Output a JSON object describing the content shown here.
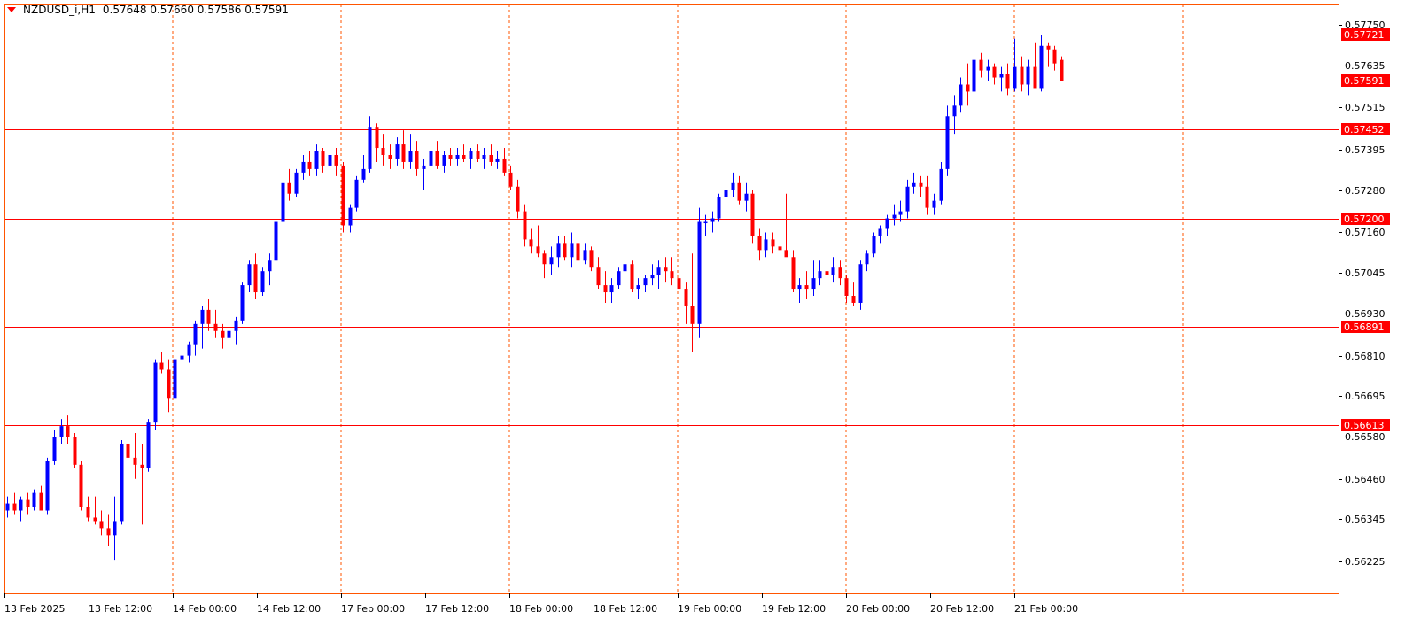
{
  "window": {
    "symbol_line": "NZDUSD_i,H1",
    "ohlc": "0.57648 0.57660 0.57586 0.57591"
  },
  "colors": {
    "bull": "#0000ff",
    "bear": "#ff0000",
    "grid": "#ff5500",
    "level_line": "#ff0000",
    "frame": "#ff5500"
  },
  "chart_data": {
    "type": "candlestick",
    "timeframe": "H1",
    "ylim": [
      0.5616,
      0.5779
    ],
    "y_ticks": [
      "0.57750",
      "0.57635",
      "0.57515",
      "0.57395",
      "0.57280",
      "0.57160",
      "0.57045",
      "0.56930",
      "0.56810",
      "0.56695",
      "0.56580",
      "0.56460",
      "0.56345",
      "0.56225"
    ],
    "x_labels": [
      "13 Feb 2025",
      "13 Feb 12:00",
      "14 Feb 00:00",
      "14 Feb 12:00",
      "17 Feb 00:00",
      "17 Feb 12:00",
      "18 Feb 00:00",
      "18 Feb 12:00",
      "19 Feb 00:00",
      "19 Feb 12:00",
      "20 Feb 00:00",
      "20 Feb 12:00",
      "21 Feb 00:00"
    ],
    "horizontal_levels": [
      {
        "label": "0.57721",
        "value": 0.57721
      },
      {
        "label": "0.57452",
        "value": 0.57452
      },
      {
        "label": "0.57200",
        "value": 0.572
      },
      {
        "label": "0.56891",
        "value": 0.56891
      },
      {
        "label": "0.56613",
        "value": 0.56613
      }
    ],
    "current_price": {
      "label": "0.57591",
      "value": 0.57591
    },
    "candles": [
      [
        0.5637,
        0.5641,
        0.5635,
        0.5639
      ],
      [
        0.5639,
        0.5642,
        0.5636,
        0.5637
      ],
      [
        0.5637,
        0.5641,
        0.5634,
        0.564
      ],
      [
        0.564,
        0.5642,
        0.5636,
        0.5638
      ],
      [
        0.5638,
        0.5643,
        0.5637,
        0.5642
      ],
      [
        0.5642,
        0.5644,
        0.5637,
        0.5637
      ],
      [
        0.5637,
        0.5652,
        0.5636,
        0.5651
      ],
      [
        0.5651,
        0.566,
        0.565,
        0.5658
      ],
      [
        0.5658,
        0.5663,
        0.5656,
        0.5661
      ],
      [
        0.5661,
        0.5664,
        0.5656,
        0.5658
      ],
      [
        0.5658,
        0.5659,
        0.5649,
        0.565
      ],
      [
        0.565,
        0.5651,
        0.5637,
        0.5638
      ],
      [
        0.5638,
        0.5641,
        0.5634,
        0.5635
      ],
      [
        0.5635,
        0.5641,
        0.5633,
        0.5634
      ],
      [
        0.5634,
        0.5637,
        0.563,
        0.5632
      ],
      [
        0.5632,
        0.5636,
        0.5627,
        0.563
      ],
      [
        0.563,
        0.5641,
        0.5623,
        0.5634
      ],
      [
        0.5634,
        0.5657,
        0.5633,
        0.5656
      ],
      [
        0.5656,
        0.5661,
        0.5649,
        0.5652
      ],
      [
        0.5652,
        0.5659,
        0.5646,
        0.565
      ],
      [
        0.565,
        0.5656,
        0.5633,
        0.5649
      ],
      [
        0.5649,
        0.5663,
        0.5648,
        0.5662
      ],
      [
        0.5662,
        0.568,
        0.566,
        0.5679
      ],
      [
        0.5679,
        0.5682,
        0.5676,
        0.5677
      ],
      [
        0.5677,
        0.568,
        0.5665,
        0.5669
      ],
      [
        0.5669,
        0.5681,
        0.5667,
        0.568
      ],
      [
        0.568,
        0.5682,
        0.5676,
        0.5681
      ],
      [
        0.5681,
        0.5685,
        0.5679,
        0.5684
      ],
      [
        0.5684,
        0.5691,
        0.5681,
        0.569
      ],
      [
        0.569,
        0.5695,
        0.5683,
        0.5694
      ],
      [
        0.5694,
        0.5697,
        0.5688,
        0.569
      ],
      [
        0.569,
        0.5694,
        0.5686,
        0.5688
      ],
      [
        0.5688,
        0.569,
        0.5683,
        0.5686
      ],
      [
        0.5686,
        0.569,
        0.5683,
        0.5688
      ],
      [
        0.5688,
        0.5692,
        0.5684,
        0.5691
      ],
      [
        0.5691,
        0.5702,
        0.569,
        0.5701
      ],
      [
        0.5701,
        0.5708,
        0.5699,
        0.5707
      ],
      [
        0.5707,
        0.571,
        0.5697,
        0.5699
      ],
      [
        0.5699,
        0.5706,
        0.5698,
        0.5705
      ],
      [
        0.5705,
        0.571,
        0.5701,
        0.5708
      ],
      [
        0.5708,
        0.5722,
        0.5707,
        0.5719
      ],
      [
        0.5719,
        0.5731,
        0.5717,
        0.573
      ],
      [
        0.573,
        0.5734,
        0.5725,
        0.5727
      ],
      [
        0.5727,
        0.5734,
        0.5726,
        0.5733
      ],
      [
        0.5733,
        0.5738,
        0.5731,
        0.5736
      ],
      [
        0.5736,
        0.5739,
        0.5732,
        0.5734
      ],
      [
        0.5734,
        0.5741,
        0.5732,
        0.5739
      ],
      [
        0.5739,
        0.574,
        0.5733,
        0.5735
      ],
      [
        0.5735,
        0.5741,
        0.5733,
        0.5738
      ],
      [
        0.5738,
        0.574,
        0.5732,
        0.5735
      ],
      [
        0.5735,
        0.5736,
        0.5716,
        0.5718
      ],
      [
        0.5718,
        0.5724,
        0.5716,
        0.5723
      ],
      [
        0.5723,
        0.5732,
        0.5722,
        0.5731
      ],
      [
        0.5731,
        0.5738,
        0.573,
        0.5734
      ],
      [
        0.5734,
        0.5749,
        0.5733,
        0.5746
      ],
      [
        0.5746,
        0.5747,
        0.5736,
        0.574
      ],
      [
        0.574,
        0.5744,
        0.5735,
        0.5738
      ],
      [
        0.5738,
        0.5741,
        0.5734,
        0.5737
      ],
      [
        0.5737,
        0.5743,
        0.5735,
        0.5741
      ],
      [
        0.5741,
        0.5745,
        0.5734,
        0.5736
      ],
      [
        0.5736,
        0.5744,
        0.5734,
        0.5739
      ],
      [
        0.5739,
        0.5742,
        0.5732,
        0.5734
      ],
      [
        0.5734,
        0.5737,
        0.5728,
        0.5735
      ],
      [
        0.5735,
        0.5741,
        0.5733,
        0.5739
      ],
      [
        0.5739,
        0.5742,
        0.5734,
        0.5735
      ],
      [
        0.5735,
        0.5739,
        0.5733,
        0.5738
      ],
      [
        0.5738,
        0.574,
        0.5735,
        0.5737
      ],
      [
        0.5737,
        0.574,
        0.5735,
        0.5738
      ],
      [
        0.5738,
        0.5741,
        0.5736,
        0.5737
      ],
      [
        0.5737,
        0.574,
        0.5734,
        0.5739
      ],
      [
        0.5739,
        0.5741,
        0.5736,
        0.5737
      ],
      [
        0.5737,
        0.574,
        0.5734,
        0.5738
      ],
      [
        0.5738,
        0.5741,
        0.5735,
        0.5736
      ],
      [
        0.5736,
        0.5739,
        0.5734,
        0.5737
      ],
      [
        0.5737,
        0.574,
        0.5732,
        0.5733
      ],
      [
        0.5733,
        0.5735,
        0.5728,
        0.5729
      ],
      [
        0.5729,
        0.5731,
        0.572,
        0.5722
      ],
      [
        0.5722,
        0.5724,
        0.5712,
        0.5714
      ],
      [
        0.5714,
        0.5717,
        0.571,
        0.5712
      ],
      [
        0.5712,
        0.5718,
        0.5709,
        0.571
      ],
      [
        0.571,
        0.5711,
        0.5703,
        0.5707
      ],
      [
        0.5707,
        0.5712,
        0.5704,
        0.5709
      ],
      [
        0.5709,
        0.5715,
        0.5706,
        0.5713
      ],
      [
        0.5713,
        0.5715,
        0.5708,
        0.5709
      ],
      [
        0.5709,
        0.5716,
        0.5706,
        0.5713
      ],
      [
        0.5713,
        0.5714,
        0.5707,
        0.5708
      ],
      [
        0.5708,
        0.5713,
        0.5707,
        0.5711
      ],
      [
        0.5711,
        0.5712,
        0.5705,
        0.5706
      ],
      [
        0.5706,
        0.5709,
        0.57,
        0.5701
      ],
      [
        0.5701,
        0.5705,
        0.5696,
        0.5699
      ],
      [
        0.5699,
        0.5703,
        0.5696,
        0.5701
      ],
      [
        0.5701,
        0.5706,
        0.57,
        0.5705
      ],
      [
        0.5705,
        0.5709,
        0.5703,
        0.5707
      ],
      [
        0.5707,
        0.5708,
        0.5699,
        0.57
      ],
      [
        0.57,
        0.5703,
        0.5697,
        0.5701
      ],
      [
        0.5701,
        0.5704,
        0.5699,
        0.5703
      ],
      [
        0.5703,
        0.5707,
        0.5701,
        0.5704
      ],
      [
        0.5704,
        0.5708,
        0.57,
        0.5706
      ],
      [
        0.5706,
        0.5709,
        0.5702,
        0.5705
      ],
      [
        0.5705,
        0.5709,
        0.5701,
        0.5703
      ],
      [
        0.5703,
        0.5706,
        0.5699,
        0.57
      ],
      [
        0.57,
        0.5702,
        0.569,
        0.5695
      ],
      [
        0.5695,
        0.571,
        0.5682,
        0.569
      ],
      [
        0.569,
        0.5723,
        0.5686,
        0.5719
      ],
      [
        0.5719,
        0.5721,
        0.5715,
        0.5719
      ],
      [
        0.5719,
        0.5722,
        0.5716,
        0.572
      ],
      [
        0.572,
        0.5727,
        0.5719,
        0.5726
      ],
      [
        0.5726,
        0.5729,
        0.5723,
        0.5728
      ],
      [
        0.5728,
        0.5733,
        0.5726,
        0.573
      ],
      [
        0.573,
        0.5732,
        0.5724,
        0.5725
      ],
      [
        0.5725,
        0.573,
        0.5722,
        0.5727
      ],
      [
        0.5727,
        0.5728,
        0.5713,
        0.5715
      ],
      [
        0.5715,
        0.5717,
        0.5708,
        0.5711
      ],
      [
        0.5711,
        0.5716,
        0.5709,
        0.5714
      ],
      [
        0.5714,
        0.5716,
        0.571,
        0.5712
      ],
      [
        0.5712,
        0.5717,
        0.5709,
        0.5711
      ],
      [
        0.5711,
        0.5727,
        0.571,
        0.5709
      ],
      [
        0.5709,
        0.5711,
        0.5699,
        0.57
      ],
      [
        0.57,
        0.5703,
        0.5696,
        0.5701
      ],
      [
        0.5701,
        0.5705,
        0.5697,
        0.57
      ],
      [
        0.57,
        0.5708,
        0.5698,
        0.5703
      ],
      [
        0.5703,
        0.5708,
        0.5701,
        0.5705
      ],
      [
        0.5705,
        0.5707,
        0.5702,
        0.5704
      ],
      [
        0.5704,
        0.5709,
        0.5702,
        0.5706
      ],
      [
        0.5706,
        0.5708,
        0.5701,
        0.5703
      ],
      [
        0.5703,
        0.5704,
        0.5696,
        0.5698
      ],
      [
        0.5698,
        0.5702,
        0.5695,
        0.5696
      ],
      [
        0.5696,
        0.5708,
        0.5694,
        0.5707
      ],
      [
        0.5707,
        0.5711,
        0.5705,
        0.571
      ],
      [
        0.571,
        0.5716,
        0.5709,
        0.5715
      ],
      [
        0.5715,
        0.5718,
        0.5713,
        0.5717
      ],
      [
        0.5717,
        0.5721,
        0.5715,
        0.572
      ],
      [
        0.572,
        0.5724,
        0.5718,
        0.5721
      ],
      [
        0.5721,
        0.5725,
        0.5719,
        0.5722
      ],
      [
        0.5722,
        0.5731,
        0.572,
        0.5729
      ],
      [
        0.5729,
        0.5733,
        0.5727,
        0.573
      ],
      [
        0.573,
        0.5732,
        0.5726,
        0.5729
      ],
      [
        0.5729,
        0.5732,
        0.5721,
        0.5723
      ],
      [
        0.5723,
        0.5727,
        0.5721,
        0.5725
      ],
      [
        0.5725,
        0.5736,
        0.5724,
        0.5734
      ],
      [
        0.5734,
        0.5752,
        0.5732,
        0.5749
      ],
      [
        0.5749,
        0.5755,
        0.5744,
        0.5752
      ],
      [
        0.5752,
        0.576,
        0.575,
        0.5758
      ],
      [
        0.5758,
        0.5764,
        0.5752,
        0.5756
      ],
      [
        0.5756,
        0.5767,
        0.5755,
        0.5765
      ],
      [
        0.5765,
        0.5767,
        0.576,
        0.5762
      ],
      [
        0.5762,
        0.5765,
        0.5759,
        0.5763
      ],
      [
        0.5763,
        0.5764,
        0.5758,
        0.576
      ],
      [
        0.576,
        0.5763,
        0.5756,
        0.5761
      ],
      [
        0.5761,
        0.5764,
        0.5755,
        0.5757
      ],
      [
        0.5757,
        0.5771,
        0.5756,
        0.5763
      ],
      [
        0.5763,
        0.5766,
        0.5756,
        0.5758
      ],
      [
        0.5758,
        0.5765,
        0.5755,
        0.5763
      ],
      [
        0.5763,
        0.577,
        0.5759,
        0.5757
      ],
      [
        0.5757,
        0.5772,
        0.5756,
        0.5769
      ],
      [
        0.5769,
        0.577,
        0.5763,
        0.5768
      ],
      [
        0.5768,
        0.5769,
        0.5762,
        0.5764
      ],
      [
        0.5765,
        0.5766,
        0.5759,
        0.5759
      ]
    ]
  }
}
